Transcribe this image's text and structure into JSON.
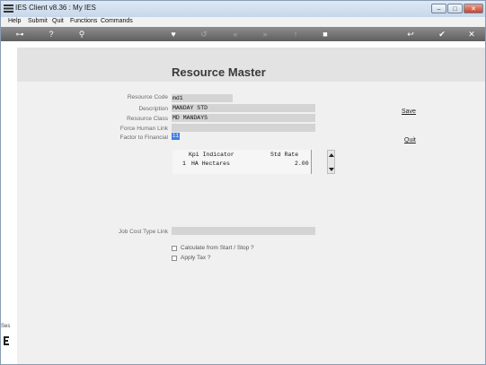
{
  "window": {
    "title": "IES Client v8.36 : My IES",
    "min_label": "–",
    "max_label": "□",
    "close_label": "✕"
  },
  "menu": [
    "Help",
    "Submit",
    "Quit",
    "Functions",
    "Commands"
  ],
  "toolbar_icons": [
    "key-icon",
    "help-icon",
    "search-icon",
    "heart-icon",
    "undo-icon",
    "rewind-icon",
    "fast-forward-icon",
    "upload-icon",
    "stop-icon",
    "back-icon",
    "check-icon",
    "close-icon"
  ],
  "page": {
    "title": "Resource Master"
  },
  "form": {
    "resource_code_label": "Resource Code",
    "resource_code_value": "md1",
    "description_label": "Description",
    "description_value": "MANDAY STD",
    "resource_class_label": "Resource Class",
    "resource_class_value": "MD MANDAYS",
    "force_human_link_label": "Force Human Link",
    "force_human_link_value": "",
    "factor_label": "Factor to Financial",
    "factor_value": "11",
    "job_cost_type_label": "Job Cost Type Link",
    "job_cost_type_value": ""
  },
  "grid": {
    "headers": [
      "Kpi Indicator",
      "Std Rate"
    ],
    "rows": [
      {
        "num": "1",
        "indicator": "HA Hectares",
        "rate": "2.00"
      }
    ]
  },
  "actions": {
    "save": "Save",
    "quit": "Quit"
  },
  "checkboxes": [
    {
      "label": "Calculate from Start / Stop ?",
      "checked": false
    },
    {
      "label": "Apply Tax ?",
      "checked": false
    }
  ],
  "side": {
    "text": "Ses"
  }
}
